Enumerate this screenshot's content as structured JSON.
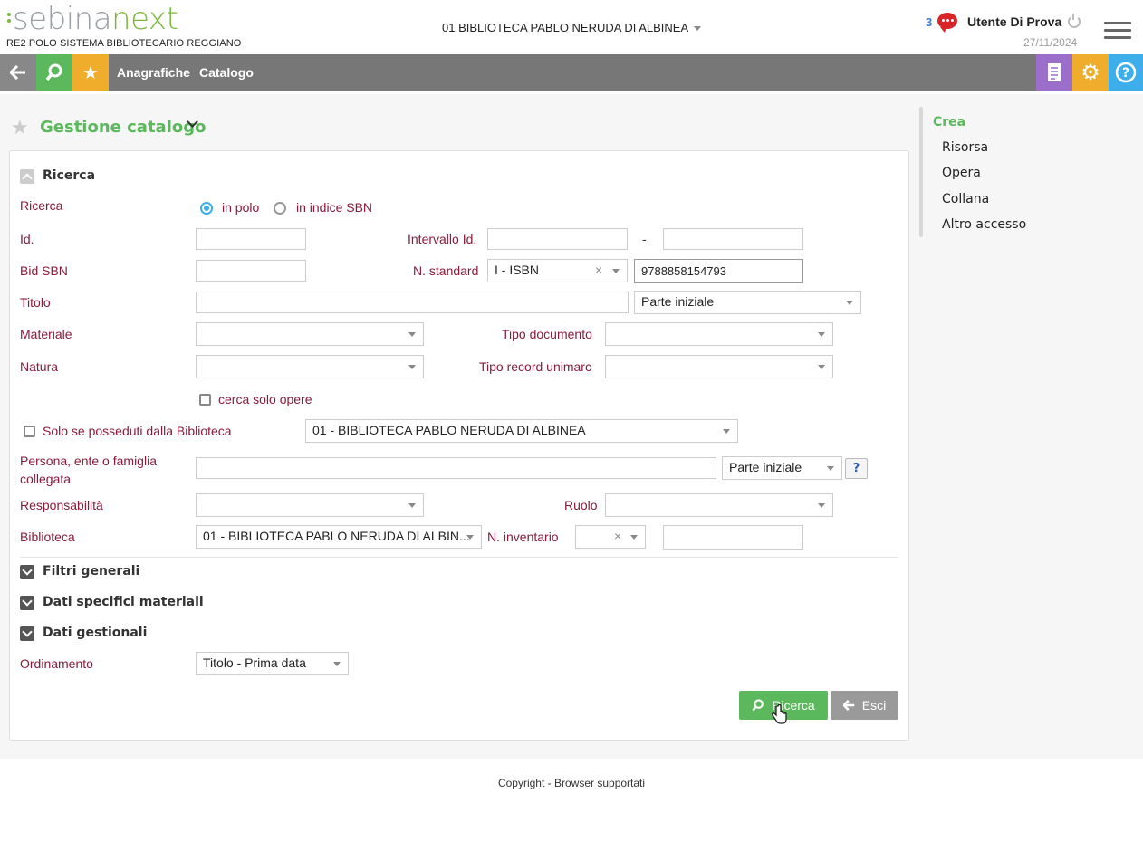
{
  "header": {
    "logo_part1": "sebina",
    "logo_part2": "next",
    "polo": "RE2 POLO SISTEMA BIBLIOTECARIO REGGIANO",
    "library": "01 BIBLIOTECA PABLO NERUDA DI ALBINEA",
    "message_count": "3",
    "user": "Utente Di Prova",
    "date": "27/11/2024"
  },
  "toolbar": {
    "links": [
      "Anagrafiche",
      "Catalogo"
    ]
  },
  "page": {
    "title": "Gestione catalogo"
  },
  "right_panel": {
    "title": "Crea",
    "items": [
      "Risorsa",
      "Opera",
      "Collana",
      "Altro accesso"
    ]
  },
  "form": {
    "section_search": "Ricerca",
    "ricerca_label": "Ricerca",
    "radio_polo": "in polo",
    "radio_indice": "in indice SBN",
    "id_label": "Id.",
    "intervallo_label": "Intervallo Id.",
    "range_sep": "-",
    "bid_label": "Bid SBN",
    "nstd_label": "N. standard",
    "nstd_type": "I - ISBN",
    "nstd_value": "9788858154793",
    "titolo_label": "Titolo",
    "titolo_mode": "Parte iniziale",
    "materiale_label": "Materiale",
    "tipodoc_label": "Tipo documento",
    "natura_label": "Natura",
    "tiporec_label": "Tipo record unimarc",
    "solo_opere": "cerca solo opere",
    "posseduti": "Solo se posseduti dalla Biblioteca",
    "posseduti_lib": "01 - BIBLIOTECA PABLO NERUDA DI ALBINEA",
    "persona_label_1": "Persona, ente o famiglia",
    "persona_label_2": "collegata",
    "persona_mode": "Parte iniziale",
    "help": "?",
    "resp_label": "Responsabilità",
    "ruolo_label": "Ruolo",
    "biblioteca_label": "Biblioteca",
    "biblioteca_value": "01 - BIBLIOTECA PABLO NERUDA DI ALBIN...",
    "ninv_label": "N. inventario",
    "sec_filtri": "Filtri generali",
    "sec_dati_mat": "Dati specifici materiali",
    "sec_gest": "Dati gestionali",
    "ord_label": "Ordinamento",
    "ord_value": "Titolo - Prima data",
    "btn_search": "Ricerca",
    "btn_exit": "Esci"
  },
  "footer": {
    "copyright": "Copyright",
    "sep": "-",
    "browsers": "Browser supportati"
  }
}
